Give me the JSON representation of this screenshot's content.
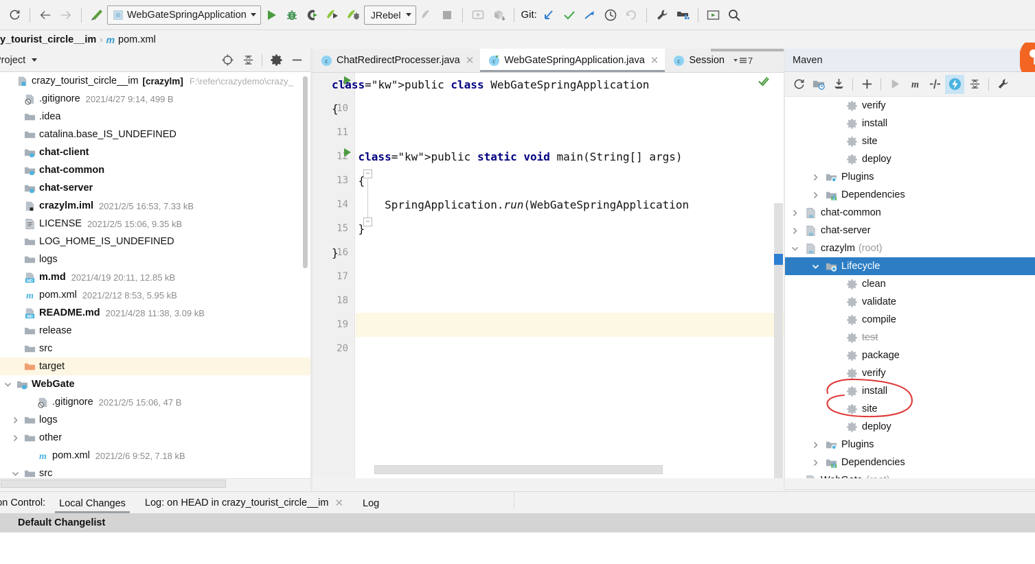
{
  "toolbar": {
    "sync_icon": "refresh-icon",
    "back_icon": "arrow-left-icon",
    "forward_icon": "arrow-right-icon",
    "hammer_icon": "build-icon",
    "run_config": "WebGateSpringApplication",
    "run_icon": "run-icon",
    "debug_icon": "debug-icon",
    "coverage_icon": "run-with-coverage-icon",
    "jrebel_run_icon": "jrebel-run-icon",
    "jrebel_debug_icon": "jrebel-debug-icon",
    "jrebel_label": "JRebel",
    "attach_icon": "attach-profiler-icon",
    "stop_icon": "stop-icon",
    "updateapp_icon": "update-application-icon",
    "package_icon": "package-download-icon",
    "git_label": "Git:",
    "git_update_icon": "git-update-project-icon",
    "git_commit_icon": "git-commit-icon",
    "git_push_icon": "git-push-icon",
    "history_icon": "history-icon",
    "rollback_icon": "rollback-icon",
    "settings_icon": "wrench-settings-icon",
    "project_structure_icon": "project-structure-icon",
    "presentation_icon": "presentation-mode-icon",
    "search_icon": "search-everywhere-icon"
  },
  "breadcrumb": {
    "root": "y_tourist_circle__im",
    "separator": "›",
    "file_icon": "maven-m-icon",
    "file": "pom.xml"
  },
  "project_panel": {
    "title": "Project",
    "caret_icon": "chevron-down-icon",
    "actions": [
      {
        "name": "select-opened-file-icon",
        "label": "locate"
      },
      {
        "name": "collapse-all-icon",
        "label": "collapse"
      },
      {
        "name": "gear-icon",
        "label": "settings"
      },
      {
        "name": "minimize-icon",
        "label": "hide"
      }
    ],
    "tree": [
      {
        "indent": 0,
        "arrow": "none",
        "icon": "module-icon",
        "name": "crazy_tourist_circle__im",
        "bold": false,
        "module": "[crazylm]",
        "path": "F:\\refer\\crazydemo\\crazy_",
        "meta": "",
        "highlight": false
      },
      {
        "indent": 1,
        "arrow": "none",
        "icon": "gitignore-icon",
        "name": ".gitignore",
        "bold": false,
        "meta": "2021/4/27 9:14, 499 B",
        "highlight": false
      },
      {
        "indent": 1,
        "arrow": "none",
        "icon": "folder-icon",
        "name": ".idea",
        "bold": false,
        "meta": "",
        "highlight": false
      },
      {
        "indent": 1,
        "arrow": "none",
        "icon": "folder-icon",
        "name": "catalina.base_IS_UNDEFINED",
        "bold": false,
        "meta": "",
        "highlight": false
      },
      {
        "indent": 1,
        "arrow": "none",
        "icon": "module-folder-icon",
        "name": "chat-client",
        "bold": true,
        "meta": "",
        "highlight": false
      },
      {
        "indent": 1,
        "arrow": "none",
        "icon": "module-folder-icon",
        "name": "chat-common",
        "bold": true,
        "meta": "",
        "highlight": false
      },
      {
        "indent": 1,
        "arrow": "none",
        "icon": "module-folder-icon",
        "name": "chat-server",
        "bold": true,
        "meta": "",
        "highlight": false
      },
      {
        "indent": 1,
        "arrow": "none",
        "icon": "iml-icon",
        "name": "crazylm.iml",
        "bold": true,
        "meta": "2021/2/5 16:53, 7.33 kB",
        "highlight": false
      },
      {
        "indent": 1,
        "arrow": "none",
        "icon": "text-file-icon",
        "name": "LICENSE",
        "bold": false,
        "meta": "2021/2/5 15:06, 9.35 kB",
        "highlight": false
      },
      {
        "indent": 1,
        "arrow": "none",
        "icon": "folder-icon",
        "name": "LOG_HOME_IS_UNDEFINED",
        "bold": false,
        "meta": "",
        "highlight": false
      },
      {
        "indent": 1,
        "arrow": "none",
        "icon": "folder-icon",
        "name": "logs",
        "bold": false,
        "meta": "",
        "highlight": false
      },
      {
        "indent": 1,
        "arrow": "none",
        "icon": "markdown-icon",
        "name": "m.md",
        "bold": true,
        "meta": "2021/4/19 20:11, 12.85 kB",
        "highlight": false
      },
      {
        "indent": 1,
        "arrow": "none",
        "icon": "maven-m-icon",
        "name": "pom.xml",
        "bold": false,
        "meta": "2021/2/12 8:53, 5.95 kB",
        "highlight": false
      },
      {
        "indent": 1,
        "arrow": "none",
        "icon": "markdown-icon",
        "name": "README.md",
        "bold": true,
        "meta": "2021/4/28 11:38, 3.09 kB",
        "highlight": false
      },
      {
        "indent": 1,
        "arrow": "none",
        "icon": "folder-icon",
        "name": "release",
        "bold": false,
        "meta": "",
        "highlight": false
      },
      {
        "indent": 1,
        "arrow": "none",
        "icon": "folder-icon",
        "name": "src",
        "bold": false,
        "meta": "",
        "highlight": false
      },
      {
        "indent": 1,
        "arrow": "none",
        "icon": "excluded-folder-icon",
        "name": "target",
        "bold": false,
        "meta": "",
        "highlight": true
      },
      {
        "indent": 0,
        "arrow": "down",
        "icon": "module-folder-icon",
        "name": "WebGate",
        "bold": true,
        "meta": "",
        "highlight": false
      },
      {
        "indent": 2,
        "arrow": "none",
        "icon": "gitignore-icon",
        "name": ".gitignore",
        "bold": false,
        "meta": "2021/2/5 15:06, 47 B",
        "highlight": false
      },
      {
        "indent": 1,
        "arrow": "right",
        "icon": "folder-icon",
        "name": "logs",
        "bold": false,
        "meta": "",
        "highlight": false
      },
      {
        "indent": 1,
        "arrow": "right",
        "icon": "folder-icon",
        "name": "other",
        "bold": false,
        "meta": "",
        "highlight": false
      },
      {
        "indent": 2,
        "arrow": "none",
        "icon": "maven-m-icon",
        "name": "pom.xml",
        "bold": false,
        "meta": "2021/2/6 9:52, 7.18 kB",
        "highlight": false
      },
      {
        "indent": 1,
        "arrow": "down",
        "icon": "folder-icon",
        "name": "src",
        "bold": false,
        "meta": "",
        "highlight": false
      }
    ]
  },
  "editor": {
    "tabs": [
      {
        "label": "ChatRedirectProcesser.java",
        "icon": "java-class-icon",
        "active": false,
        "closable": true
      },
      {
        "label": "WebGateSpringApplication.java",
        "icon": "java-runnable-class-icon",
        "active": true,
        "closable": true
      },
      {
        "label": "Session",
        "icon": "java-class-icon",
        "active": false,
        "closable": false
      }
    ],
    "tab_overflow_count": "7",
    "tab_overflow_icon": "tab-list-icon",
    "inspection_icon": "inspections-ok-icon",
    "lines": [
      {
        "num": "9",
        "text": "public class WebGateSpringApplication",
        "gutter_icon": "run-gutter-icon",
        "highlight": false
      },
      {
        "num": "10",
        "text": "{",
        "gutter_icon": "",
        "highlight": false
      },
      {
        "num": "11",
        "text": "",
        "gutter_icon": "",
        "highlight": false
      },
      {
        "num": "12",
        "text": "    public static void main(String[] args)",
        "gutter_icon": "run-gutter-icon",
        "highlight": false
      },
      {
        "num": "13",
        "text": "    {",
        "gutter_icon": "fold-open-icon",
        "highlight": false
      },
      {
        "num": "14",
        "text": "        SpringApplication.run(WebGateSpringApplication",
        "gutter_icon": "",
        "highlight": false
      },
      {
        "num": "15",
        "text": "    }",
        "gutter_icon": "fold-close-icon",
        "highlight": false
      },
      {
        "num": "16",
        "text": "}",
        "gutter_icon": "",
        "highlight": false
      },
      {
        "num": "17",
        "text": "",
        "gutter_icon": "",
        "highlight": false
      },
      {
        "num": "18",
        "text": "",
        "gutter_icon": "",
        "highlight": false
      },
      {
        "num": "19",
        "text": "",
        "gutter_icon": "",
        "highlight": true
      },
      {
        "num": "20",
        "text": "",
        "gutter_icon": "",
        "highlight": false
      }
    ],
    "keywords": [
      "public",
      "class",
      "static",
      "void"
    ]
  },
  "maven_panel": {
    "title": "Maven",
    "toolbar": [
      {
        "name": "reimport-icon",
        "active": false
      },
      {
        "name": "generate-sources-icon",
        "active": false
      },
      {
        "name": "download-sources-icon",
        "active": false
      },
      {
        "name": "add-maven-project-icon",
        "active": false
      },
      {
        "name": "run-maven-build-icon",
        "active": false
      },
      {
        "name": "execute-maven-goal-icon",
        "active": false
      },
      {
        "name": "toggle-offline-icon",
        "active": false
      },
      {
        "name": "toggle-skip-tests-icon",
        "active": true
      },
      {
        "name": "collapse-all-icon",
        "active": false
      },
      {
        "name": "maven-settings-icon",
        "active": false
      }
    ],
    "tree": [
      {
        "indent": 3,
        "arrow": "none",
        "icon": "goal-icon",
        "name": "verify",
        "root": "",
        "selected": false,
        "strike": false
      },
      {
        "indent": 3,
        "arrow": "none",
        "icon": "goal-icon",
        "name": "install",
        "root": "",
        "selected": false,
        "strike": false
      },
      {
        "indent": 3,
        "arrow": "none",
        "icon": "goal-icon",
        "name": "site",
        "root": "",
        "selected": false,
        "strike": false
      },
      {
        "indent": 3,
        "arrow": "none",
        "icon": "goal-icon",
        "name": "deploy",
        "root": "",
        "selected": false,
        "strike": false
      },
      {
        "indent": 2,
        "arrow": "right",
        "icon": "plugins-icon",
        "name": "Plugins",
        "root": "",
        "selected": false,
        "strike": false
      },
      {
        "indent": 2,
        "arrow": "right",
        "icon": "dependencies-icon",
        "name": "Dependencies",
        "root": "",
        "selected": false,
        "strike": false
      },
      {
        "indent": 1,
        "arrow": "right",
        "icon": "maven-project-icon",
        "name": "chat-common",
        "root": "",
        "selected": false,
        "strike": false
      },
      {
        "indent": 1,
        "arrow": "right",
        "icon": "maven-project-icon",
        "name": "chat-server",
        "root": "",
        "selected": false,
        "strike": false
      },
      {
        "indent": 1,
        "arrow": "down",
        "icon": "maven-project-icon",
        "name": "crazylm",
        "root": "(root)",
        "selected": false,
        "strike": false
      },
      {
        "indent": 2,
        "arrow": "down",
        "icon": "lifecycle-icon",
        "name": "Lifecycle",
        "root": "",
        "selected": true,
        "strike": false
      },
      {
        "indent": 3,
        "arrow": "none",
        "icon": "goal-icon",
        "name": "clean",
        "root": "",
        "selected": false,
        "strike": false
      },
      {
        "indent": 3,
        "arrow": "none",
        "icon": "goal-icon",
        "name": "validate",
        "root": "",
        "selected": false,
        "strike": false
      },
      {
        "indent": 3,
        "arrow": "none",
        "icon": "goal-icon",
        "name": "compile",
        "root": "",
        "selected": false,
        "strike": false
      },
      {
        "indent": 3,
        "arrow": "none",
        "icon": "goal-icon",
        "name": "test",
        "root": "",
        "selected": false,
        "strike": true
      },
      {
        "indent": 3,
        "arrow": "none",
        "icon": "goal-icon",
        "name": "package",
        "root": "",
        "selected": false,
        "strike": false
      },
      {
        "indent": 3,
        "arrow": "none",
        "icon": "goal-icon",
        "name": "verify",
        "root": "",
        "selected": false,
        "strike": false
      },
      {
        "indent": 3,
        "arrow": "none",
        "icon": "goal-icon",
        "name": "install",
        "root": "",
        "selected": false,
        "strike": false
      },
      {
        "indent": 3,
        "arrow": "none",
        "icon": "goal-icon",
        "name": "site",
        "root": "",
        "selected": false,
        "strike": false
      },
      {
        "indent": 3,
        "arrow": "none",
        "icon": "goal-icon",
        "name": "deploy",
        "root": "",
        "selected": false,
        "strike": false
      },
      {
        "indent": 2,
        "arrow": "right",
        "icon": "plugins-icon",
        "name": "Plugins",
        "root": "",
        "selected": false,
        "strike": false
      },
      {
        "indent": 2,
        "arrow": "right",
        "icon": "dependencies-icon",
        "name": "Dependencies",
        "root": "",
        "selected": false,
        "strike": false
      },
      {
        "indent": 1,
        "arrow": "down",
        "icon": "maven-project-icon",
        "name": "WebGate",
        "root": "(root)",
        "selected": false,
        "strike": false
      }
    ],
    "annotation": {
      "shape": "hand-drawn-circle",
      "color": "#e03a3a",
      "encircles": [
        "install",
        "site"
      ]
    }
  },
  "version_control": {
    "label": "ion Control:",
    "tabs": [
      {
        "label": "Local Changes",
        "active": true,
        "closable": false
      },
      {
        "label": "Log: on HEAD in crazy_tourist_circle__im",
        "active": false,
        "closable": true
      },
      {
        "label": "Log",
        "active": false,
        "closable": false
      }
    ],
    "changelist": "Default Changelist"
  },
  "colors": {
    "accent_blue": "#2d7dc4",
    "selection_highlight": "#fdf6e3",
    "annotation_red": "#e03a3a",
    "jrebel_orange": "#f26522",
    "keyword_navy": "#000080",
    "run_green": "#4a9b3e"
  }
}
